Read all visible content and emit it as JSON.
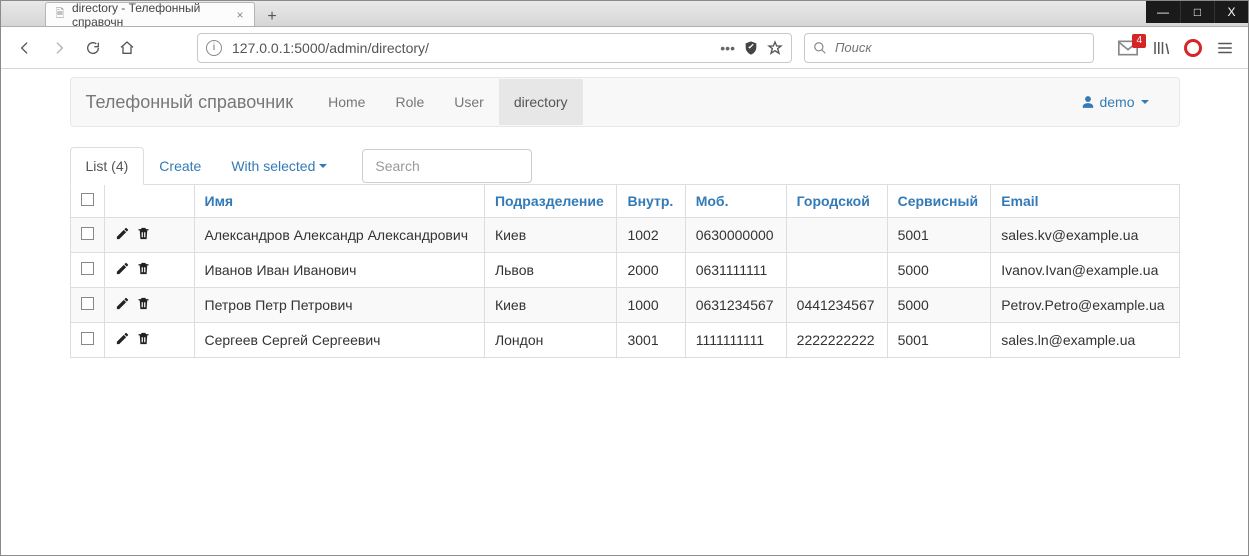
{
  "window": {
    "tab_title": "directory - Телефонный справочн",
    "min": "—",
    "max": "□",
    "close": "X"
  },
  "toolbar": {
    "url": "127.0.0.1:5000/admin/directory/",
    "search_placeholder": "Поиск",
    "notif_badge": "4"
  },
  "navbar": {
    "brand": "Телефонный справочник",
    "items": [
      {
        "label": "Home",
        "active": false
      },
      {
        "label": "Role",
        "active": false
      },
      {
        "label": "User",
        "active": false
      },
      {
        "label": "directory",
        "active": true
      }
    ],
    "user": "demo"
  },
  "actions": {
    "list_label": "List (4)",
    "create": "Create",
    "with_selected": "With selected",
    "search_placeholder": "Search"
  },
  "table": {
    "headers": {
      "name": "Имя",
      "dept": "Подразделение",
      "ext": "Внутр.",
      "mob": "Моб.",
      "city": "Городской",
      "service": "Сервисный",
      "email": "Email"
    },
    "rows": [
      {
        "name": "Александров Александр Александрович",
        "dept": "Киев",
        "ext": "1002",
        "mob": "0630000000",
        "city": "",
        "service": "5001",
        "email": "sales.kv@example.ua"
      },
      {
        "name": "Иванов Иван Иванович",
        "dept": "Львов",
        "ext": "2000",
        "mob": "0631111111",
        "city": "",
        "service": "5000",
        "email": "Ivanov.Ivan@example.ua"
      },
      {
        "name": "Петров Петр Петрович",
        "dept": "Киев",
        "ext": "1000",
        "mob": "0631234567",
        "city": "0441234567",
        "service": "5000",
        "email": "Petrov.Petro@example.ua"
      },
      {
        "name": "Сергеев Сергей Сергеевич",
        "dept": "Лондон",
        "ext": "3001",
        "mob": "1111111111",
        "city": "2222222222",
        "service": "5001",
        "email": "sales.ln@example.ua"
      }
    ]
  }
}
